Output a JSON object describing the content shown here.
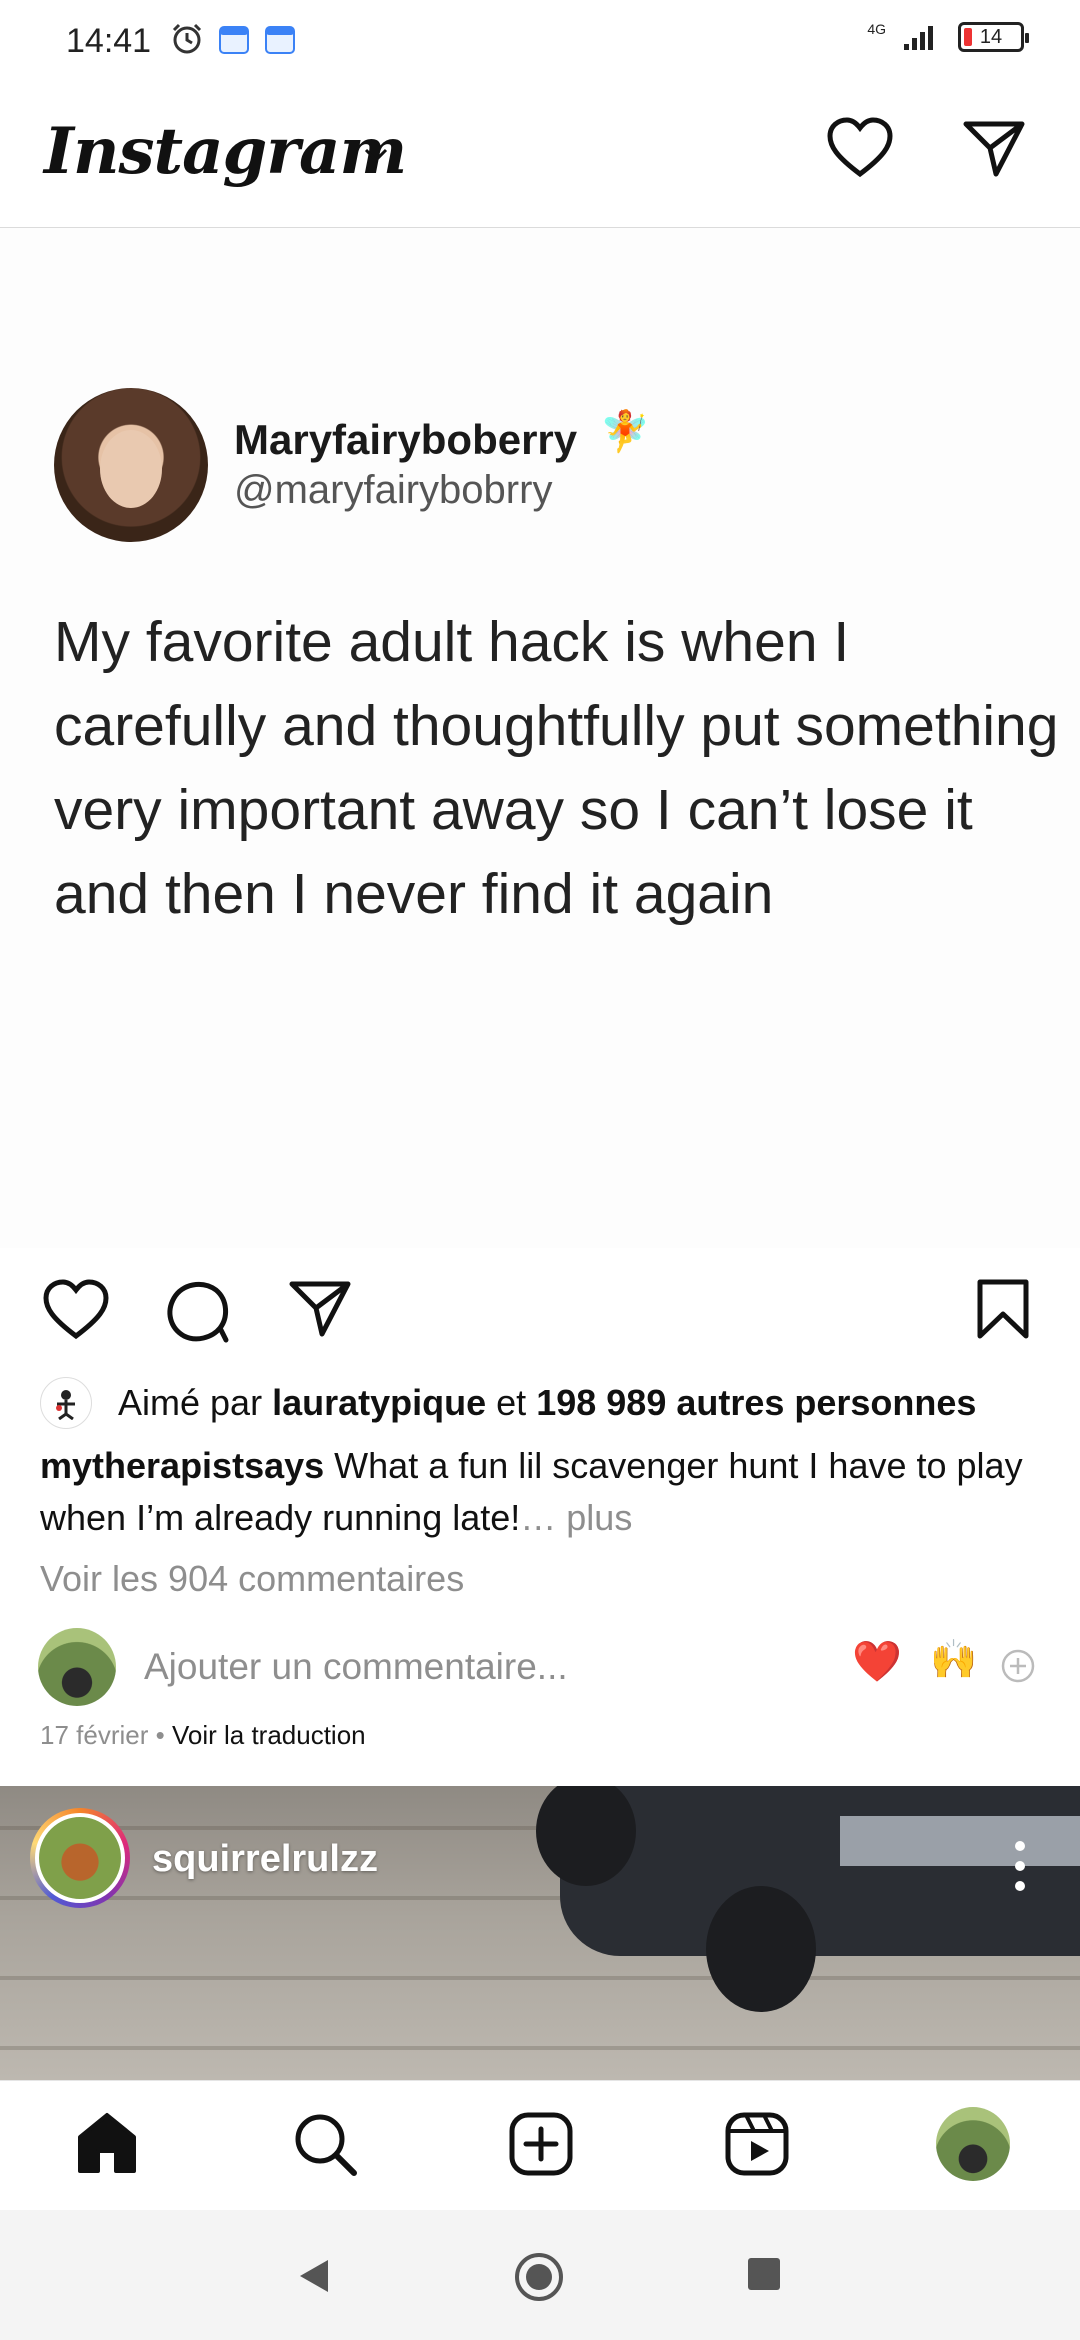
{
  "status_bar": {
    "time": "14:41",
    "network": "4G",
    "battery": "14",
    "icons": [
      "alarm-icon",
      "calendar-icon",
      "calendar-icon",
      "signal-icon",
      "battery-icon"
    ]
  },
  "header": {
    "logo": "Instagram",
    "icons": [
      "chevron-down-icon",
      "heart-icon",
      "direct-message-icon"
    ]
  },
  "post": {
    "tweet": {
      "name": "Maryfairyboberry",
      "name_emoji": "🧚",
      "handle": "@maryfairybobrry",
      "text": "My favorite adult hack is when I carefully and thoughtfully put something very important away so I can’t lose it and then I never find it again"
    },
    "actions": [
      "like-icon",
      "comment-icon",
      "share-icon",
      "save-icon"
    ],
    "likes": {
      "prefix": "Aimé par",
      "user": "lauratypique",
      "middle": "et",
      "count_text": "198 989 autres personnes"
    },
    "caption": {
      "username": "mytherapistsays",
      "text": "What a fun lil scavenger hunt I have to play when I’m already running late!",
      "more": "… plus"
    },
    "view_comments": "Voir les 904 commentaires",
    "comment_placeholder": "Ajouter un commentaire...",
    "quick_emojis": [
      "❤️",
      "🙌"
    ],
    "date": "17 février",
    "date_separator": " • ",
    "translate": "Voir la traduction"
  },
  "next_post": {
    "username": "squirrelrulzz"
  },
  "bottom_nav": [
    "home-icon",
    "search-icon",
    "new-post-icon",
    "reels-icon",
    "profile-avatar"
  ],
  "system_nav": [
    "back-icon",
    "home-circle-icon",
    "recents-icon"
  ],
  "colors": {
    "text": "#111111",
    "muted": "#8e8e8e",
    "like_red": "#e0242f",
    "divider": "#dbdbdb"
  }
}
